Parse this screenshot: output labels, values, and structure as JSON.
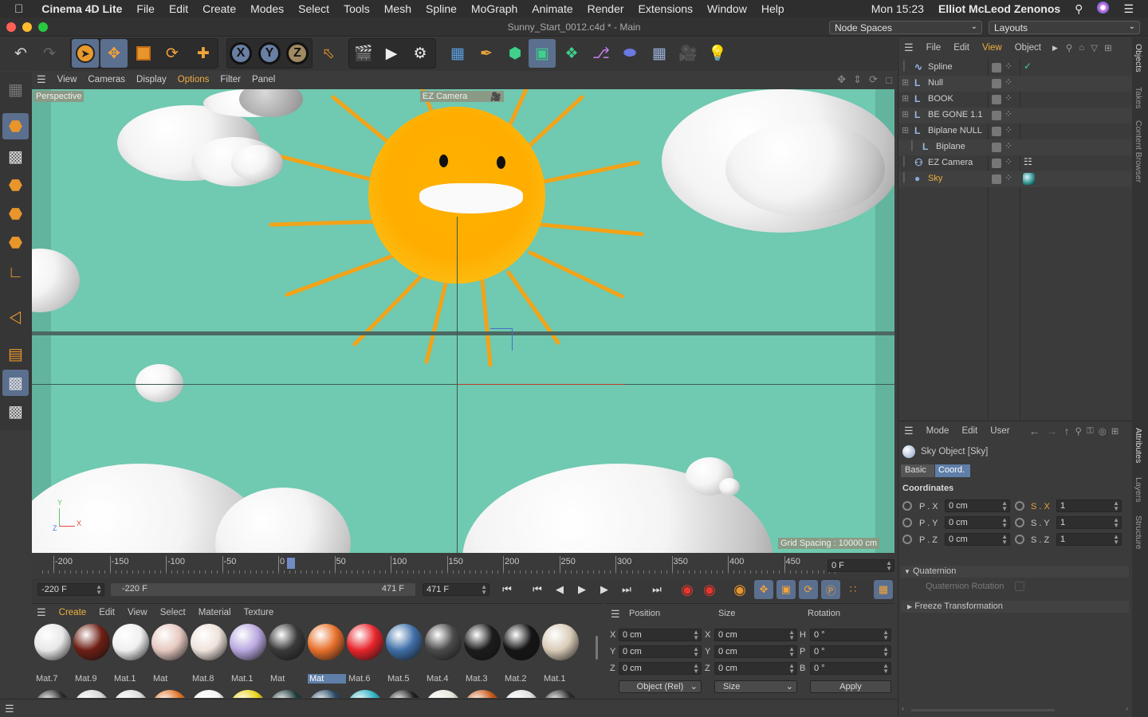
{
  "menubar": {
    "app_name": "Cinema 4D Lite",
    "items": [
      "File",
      "Edit",
      "Create",
      "Modes",
      "Select",
      "Tools",
      "Mesh",
      "Spline",
      "MoGraph",
      "Animate",
      "Render",
      "Extensions",
      "Window",
      "Help"
    ],
    "clock": "Mon 15:23",
    "user": "Elliot McLeod Zenonos"
  },
  "window": {
    "title": "Sunny_Start_0012.c4d * - Main",
    "node_spaces": "Node Spaces",
    "layouts": "Layouts"
  },
  "viewport": {
    "menu": [
      "View",
      "Cameras",
      "Display",
      "Options",
      "Filter",
      "Panel"
    ],
    "active_menu": "Options",
    "projection_label": "Perspective",
    "camera_label": "EZ Camera",
    "grid_spacing": "Grid Spacing : 10000 cm",
    "axis_y": "Y",
    "axis_z": "Z",
    "axis_x": "X"
  },
  "timeline": {
    "ticks": [
      "-200",
      "-150",
      "-100",
      "-50",
      "0",
      "50",
      "100",
      "150",
      "200",
      "250",
      "300",
      "350",
      "400",
      "450"
    ],
    "current_frame": "0 F",
    "start_frame": "-220 F",
    "range_start": "-220 F",
    "range_end": "471 F",
    "end_frame": "471 F"
  },
  "materials": {
    "menu": [
      "Create",
      "Edit",
      "View",
      "Select",
      "Material",
      "Texture"
    ],
    "row1": [
      {
        "name": "Mat.7",
        "color": "#e8e8e8"
      },
      {
        "name": "Mat.9",
        "color": "#6e1f14"
      },
      {
        "name": "Mat.1",
        "color": "#f0f0f0"
      },
      {
        "name": "Mat",
        "color": "#e6c9c0"
      },
      {
        "name": "Mat.8",
        "color": "#efe3dc"
      },
      {
        "name": "Mat.1",
        "color": "#b9a8e0"
      },
      {
        "name": "Mat",
        "color": "#3a3a3a"
      },
      {
        "name": "Mat",
        "color": "#e8702a"
      },
      {
        "name": "Mat.6",
        "color": "#e8252b"
      },
      {
        "name": "Mat.5",
        "color": "#3f6fa8"
      },
      {
        "name": "Mat.4",
        "color": "#4a4a4a"
      },
      {
        "name": "Mat.3",
        "color": "#1c1c1c"
      },
      {
        "name": "Mat.2",
        "color": "#151515"
      },
      {
        "name": "Mat.1",
        "color": "#d9ccb8"
      }
    ],
    "selected_index": 7,
    "row2_colors": [
      "#2a2a2a",
      "#d8d8d8",
      "#dcdcdc",
      "#e2732a",
      "#f2f2f2",
      "#e8d21a",
      "#1f3c3a",
      "#2a4a66",
      "#2fb3c4",
      "#202020",
      "#e8e4dc",
      "#c85a18",
      "#e0e0e0",
      "#2a2a2a"
    ]
  },
  "coords": {
    "headers": [
      "Position",
      "Size",
      "Rotation"
    ],
    "rows": [
      {
        "axis": "X",
        "pos": "0 cm",
        "size_axis": "X",
        "size": "0 cm",
        "rot_axis": "H",
        "rot": "0 °"
      },
      {
        "axis": "Y",
        "pos": "0 cm",
        "size_axis": "Y",
        "size": "0 cm",
        "rot_axis": "P",
        "rot": "0 °"
      },
      {
        "axis": "Z",
        "pos": "0 cm",
        "size_axis": "Z",
        "size": "0 cm",
        "rot_axis": "B",
        "rot": "0 °"
      }
    ],
    "mode_select": "Object (Rel)",
    "size_select": "Size",
    "apply": "Apply"
  },
  "objects": {
    "menu": [
      "File",
      "Edit",
      "View",
      "Object"
    ],
    "active_menu": "View",
    "items": [
      {
        "name": "Spline",
        "indent": 0
      },
      {
        "name": "Null",
        "indent": 0
      },
      {
        "name": "BOOK",
        "indent": 0
      },
      {
        "name": "BE GONE 1.1",
        "indent": 0
      },
      {
        "name": "Biplane NULL",
        "indent": 0
      },
      {
        "name": "Biplane",
        "indent": 1
      },
      {
        "name": "EZ Camera",
        "indent": 0
      },
      {
        "name": "Sky",
        "indent": 0
      }
    ],
    "selected_name": "Sky"
  },
  "attributes": {
    "menu": [
      "Mode",
      "Edit",
      "User"
    ],
    "object_title": "Sky Object [Sky]",
    "tabs": [
      "Basic",
      "Coord."
    ],
    "active_tab": "Coord.",
    "section": "Coordinates",
    "rows": [
      {
        "p_label": "P . X",
        "p_val": "0 cm",
        "s_label": "S . X",
        "s_val": "1"
      },
      {
        "p_label": "P . Y",
        "p_val": "0 cm",
        "s_label": "S . Y",
        "s_val": "1"
      },
      {
        "p_label": "P . Z",
        "p_val": "0 cm",
        "s_label": "S . Z",
        "s_val": "1"
      }
    ],
    "quaternion": "Quaternion",
    "quaternion_rotation": "Quaternion Rotation",
    "freeze": "Freeze Transformation"
  },
  "sidetabs": [
    "Objects",
    "Takes",
    "Content Browser",
    "Attributes",
    "Layers",
    "Structure"
  ]
}
